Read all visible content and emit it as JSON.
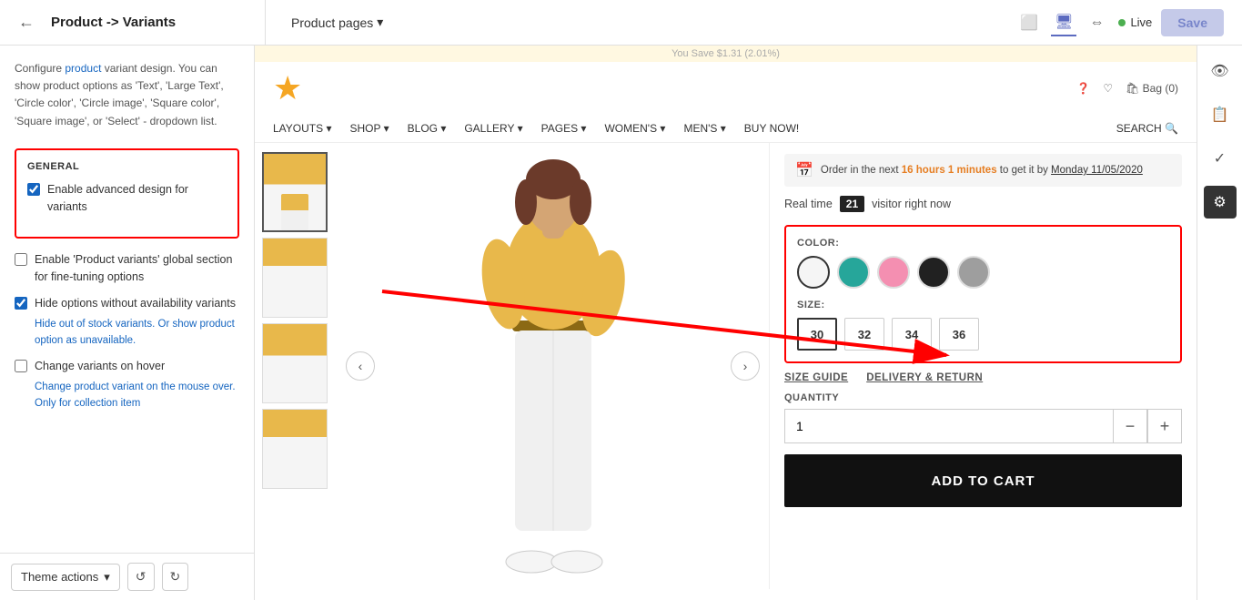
{
  "topbar": {
    "back_label": "←",
    "breadcrumb": "Product -> Variants",
    "product_pages": "Product pages",
    "dropdown_icon": "▾",
    "live_label": "Live",
    "save_label": "Save"
  },
  "sidebar": {
    "description": "Configure product variant design. You can show product options as 'Text', 'Large Text', 'Circle color', 'Circle image', 'Square color', 'Square image', or 'Select' - dropdown list.",
    "general_title": "GENERAL",
    "checkboxes": [
      {
        "id": "cb1",
        "label": "Enable advanced design for variants",
        "checked": true,
        "hint": ""
      },
      {
        "id": "cb2",
        "label": "Enable 'Product variants' global section for fine-tuning options",
        "checked": false,
        "hint": ""
      },
      {
        "id": "cb3",
        "label": "Hide options without availability variants",
        "checked": true,
        "hint": "Hide out of stock variants. Or show product option as unavailable."
      },
      {
        "id": "cb4",
        "label": "Change variants on hover",
        "checked": false,
        "hint": "Change product variant on the mouse over. Only for collection item"
      }
    ],
    "theme_actions_label": "Theme actions",
    "dropdown_icon": "▾"
  },
  "store": {
    "savings_bar": "You Save $1.31 (2.01%)",
    "nav_items": [
      "LAYOUTS ▾",
      "SHOP ▾",
      "BLOG ▾",
      "GALLERY ▾",
      "PAGES ▾",
      "WOMEN'S ▾",
      "MEN'S ▾",
      "BUY NOW!",
      "SEARCH 🔍"
    ],
    "order_banner": "Order in the next 16 hours 1 minutes to get it by Monday 11/05/2020",
    "realtime_label": "Real time",
    "visitor_count": "21",
    "visitor_suffix": "visitor right now",
    "color_label": "COLOR:",
    "colors": [
      "white",
      "teal",
      "pink",
      "black",
      "gray"
    ],
    "size_label": "SIZE:",
    "sizes": [
      "30",
      "32",
      "34",
      "36"
    ],
    "selected_size": "30",
    "links": [
      "SIZE GUIDE",
      "DELIVERY & RETURN"
    ],
    "quantity_label": "QUANTITY",
    "quantity_value": "1",
    "add_to_cart_label": "ADD TO CART",
    "minus_label": "−",
    "plus_label": "+"
  },
  "right_panel_icons": [
    "👁",
    "📋",
    "✓",
    "⚙"
  ]
}
